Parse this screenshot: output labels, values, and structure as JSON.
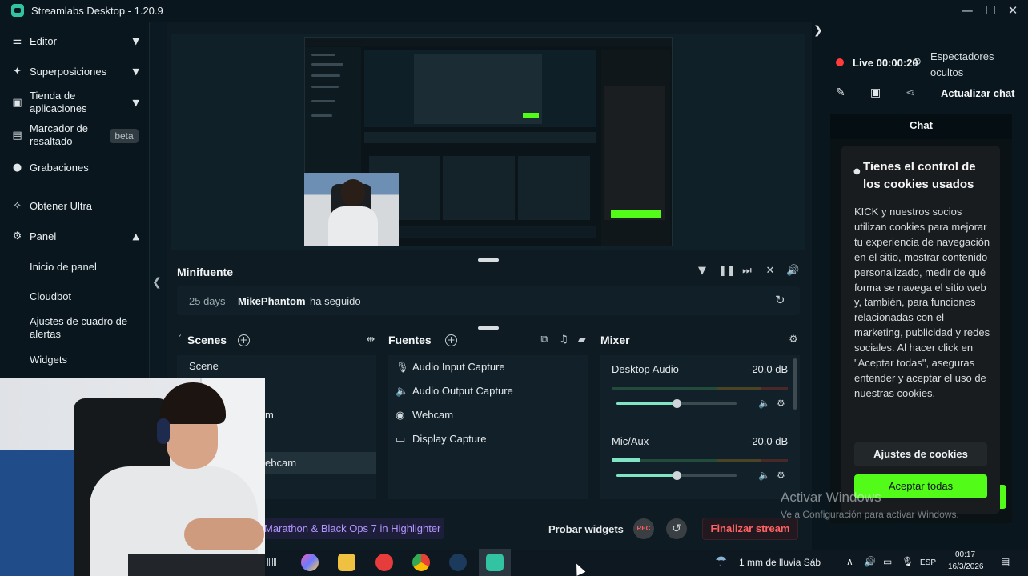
{
  "window": {
    "title": "Streamlabs Desktop - 1.20.9",
    "controls": [
      "minimize",
      "maximize",
      "close"
    ]
  },
  "sidebar": {
    "items": [
      {
        "label": "Editor",
        "icon": "sliders-icon"
      },
      {
        "label": "Superposiciones",
        "icon": "overlay-icon"
      },
      {
        "label": "Tienda de aplicaciones",
        "icon": "store-icon"
      },
      {
        "label": "Marcador de resaltado",
        "icon": "highlighter-icon",
        "badge": "beta"
      },
      {
        "label": "Grabaciones",
        "icon": "record-icon"
      },
      {
        "label": "Obtener Ultra",
        "icon": "ultra-icon"
      },
      {
        "label": "Panel",
        "icon": "dashboard-icon"
      }
    ],
    "panel_subitems": [
      "Inicio de panel",
      "Cloudbot",
      "Ajustes de cuadro de alertas",
      "Widgets"
    ]
  },
  "minifuente": {
    "title": "Minifuente",
    "event": {
      "days": "25 days",
      "user": "MikePhantom",
      "action": "ha seguido"
    }
  },
  "scenes": {
    "title": "Scenes",
    "items": [
      "Scene",
      "m",
      "ebcam"
    ]
  },
  "fuentes": {
    "title": "Fuentes",
    "items": [
      {
        "label": "Audio Input Capture",
        "icon": "microphone-icon"
      },
      {
        "label": "Audio Output Capture",
        "icon": "speaker-icon"
      },
      {
        "label": "Webcam",
        "icon": "webcam-icon"
      },
      {
        "label": "Display Capture",
        "icon": "monitor-icon"
      }
    ]
  },
  "mixer": {
    "title": "Mixer",
    "channels": [
      {
        "name": "Desktop Audio",
        "db": "-20.0 dB",
        "level": 0.5
      },
      {
        "name": "Mic/Aux",
        "db": "-20.0 dB",
        "level": 0.5
      }
    ]
  },
  "footer": {
    "promo": "Marathon & Black Ops 7 in Highlighter",
    "test_widgets": "Probar widgets",
    "rec": "REC",
    "end_stream": "Finalizar stream"
  },
  "live": {
    "label": "Live 00:00:20",
    "viewers": "Espectadores ocultos",
    "refresh_chat": "Actualizar chat"
  },
  "chat": {
    "title": "Chat",
    "cookie_title": "Tienes el control de los cookies usados",
    "cookie_text": "KICK y nuestros socios utilizan cookies para mejorar tu experiencia de navegación en el sitio, mostrar contenido personalizado, medir de qué forma se navega el sitio web y, también, para funciones relacionadas con el marketing, publicidad y redes sociales. Al hacer click en \"Aceptar todas\", aseguras entender y aceptar el uso de nuestras cookies.",
    "cookie_settings": "Ajustes de cookies",
    "accept_all": "Aceptar todas",
    "accent": "#53fc18"
  },
  "watermark": {
    "title": "Activar Windows",
    "subtitle": "Ve a Configuración para activar Windows."
  },
  "taskbar": {
    "weather": "1 mm de lluvia Sáb",
    "lang": "ESP",
    "time": "00:17",
    "date": "16/3/2026"
  },
  "colors": {
    "accent": "#31c3a2",
    "background": "#09161d",
    "end_stream": "#ff6363"
  }
}
